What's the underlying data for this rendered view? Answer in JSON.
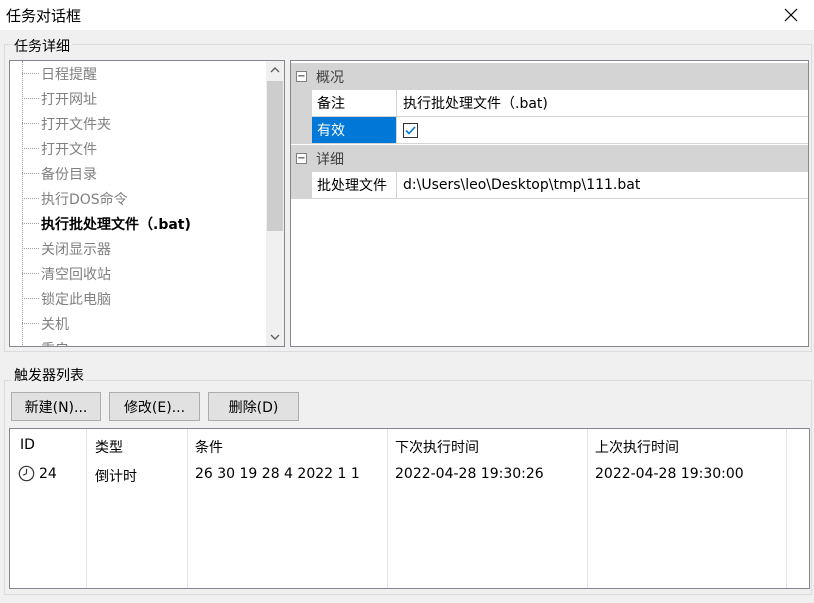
{
  "window": {
    "title": "任务对话框",
    "close_icon": "close-icon"
  },
  "task_details": {
    "caption": "任务详细",
    "tree_items": [
      {
        "label": "日程提醒",
        "selected": false
      },
      {
        "label": "打开网址",
        "selected": false
      },
      {
        "label": "打开文件夹",
        "selected": false
      },
      {
        "label": "打开文件",
        "selected": false
      },
      {
        "label": "备份目录",
        "selected": false
      },
      {
        "label": "执行DOS命令",
        "selected": false
      },
      {
        "label": "执行批处理文件（.bat)",
        "selected": true
      },
      {
        "label": "关闭显示器",
        "selected": false
      },
      {
        "label": "清空回收站",
        "selected": false
      },
      {
        "label": "锁定此电脑",
        "selected": false
      },
      {
        "label": "关机",
        "selected": false
      },
      {
        "label": "重启",
        "selected": false
      }
    ],
    "scroll_up_icon": "chevron-up-icon",
    "scroll_down_icon": "chevron-down-icon"
  },
  "properties": {
    "category_overview": {
      "label": "概况",
      "toggle": "⊟"
    },
    "note": {
      "name": "备注",
      "value": "执行批处理文件（.bat)"
    },
    "enabled": {
      "name": "有效",
      "checked": true
    },
    "category_details": {
      "label": "详细",
      "toggle": "⊟"
    },
    "batch_file": {
      "name": "批处理文件",
      "value": "d:\\Users\\leo\\Desktop\\tmp\\111.bat"
    }
  },
  "triggers": {
    "caption": "触发器列表",
    "buttons": {
      "new": "新建(N)...",
      "modify": "修改(E)...",
      "delete": "删除(D)"
    },
    "columns": [
      "ID",
      "类型",
      "条件",
      "下次执行时间",
      "上次执行时间"
    ],
    "rows": [
      {
        "icon": "clock-icon",
        "id": "24",
        "type": "倒计时",
        "condition": "26 30 19 28 4 2022 1 1",
        "next_run": "2022-04-28 19:30:26",
        "last_run": "2022-04-28 19:30:00"
      }
    ]
  },
  "colors": {
    "selection": "#0078d7",
    "category_bg": "#d4d4d4",
    "window_bg": "#f0f0f0"
  }
}
